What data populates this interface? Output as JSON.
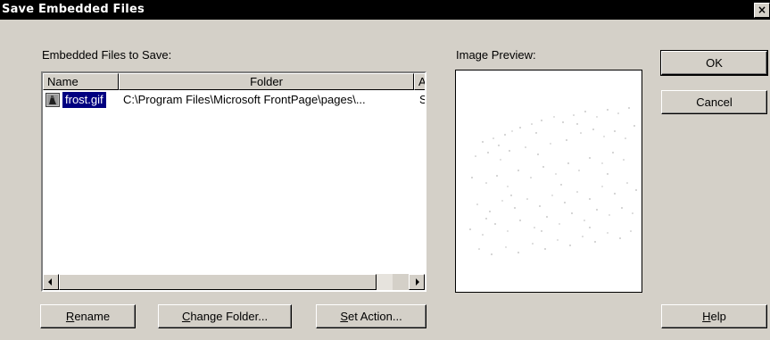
{
  "window": {
    "title": "Save Embedded Files",
    "close_glyph": "×"
  },
  "labels": {
    "files_to_save": "Embedded Files to Save:",
    "image_preview": "Image Preview:"
  },
  "list": {
    "columns": [
      "Name",
      "Folder",
      "A"
    ],
    "rows": [
      {
        "icon": "gif-image-icon",
        "name": "frost.gif",
        "folder": "C:\\Program Files\\Microsoft FrontPage\\pages\\...",
        "action": "S"
      }
    ]
  },
  "buttons": {
    "ok": "OK",
    "cancel": "Cancel",
    "help_mnemonic": "H",
    "help_rest": "elp",
    "rename_mnemonic": "R",
    "rename_rest": "ename",
    "change_folder_mnemonic": "C",
    "change_folder_rest": "hange Folder...",
    "set_action_mnemonic": "S",
    "set_action_rest": "et Action..."
  },
  "colors": {
    "face": "#d4d0c8",
    "titlebar": "#000000",
    "selection": "#000080"
  }
}
